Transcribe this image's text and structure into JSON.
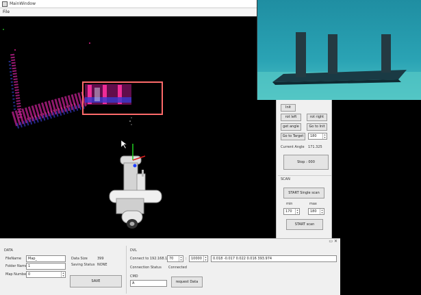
{
  "window": {
    "title": "MainWindow"
  },
  "menu": {
    "file": "File"
  },
  "controls": {
    "init_button": "Init",
    "rot_left_button": "rot left",
    "rot_right_button": "rot right",
    "get_angle_button": "get angle",
    "go_init_button": "Go to Init",
    "go_target_button": "Go to Target",
    "target_value": "180",
    "current_angle_label": "Current Angle",
    "current_angle_value": "171.325",
    "stop_button": "Stop : 000",
    "scan_section_label": "SCAN",
    "start_single_scan_button": "START Single scan",
    "min_label": "min",
    "max_label": "max",
    "min_value": "170",
    "max_value": "180",
    "start_scan_button": "START scan"
  },
  "dock": {
    "float_icon": "▭",
    "close_icon": "✕",
    "data": {
      "section_label": "DATA",
      "filename_label": "FileName",
      "filename_value": "Map_",
      "folder_label": "Folder Name",
      "folder_value": "1",
      "mapnum_label": "Map Number",
      "mapnum_value": "0",
      "data_size_label": "Data Size",
      "data_size_value": "399",
      "saving_status_label": "Saving Status",
      "saving_status_value": "NONE",
      "save_button": "SAVE"
    },
    "dvl": {
      "section_label": "DVL",
      "connect_label": "Connect to 192.168.1.",
      "ip_suffix": "70",
      "port_value": "10000",
      "port_sep": ":",
      "readout": "0.018 -0.017 0.022 0.016 393.974",
      "conn_status_label": "Connection Status",
      "conn_status_value": "Connected",
      "cmd_label": "CMD",
      "cmd_value": "A",
      "request_button": "request Data"
    }
  },
  "colors": {
    "point_cloud_pink": "#e0208f",
    "point_cloud_blue": "#2030c0",
    "roi_box": "#ff6b6b",
    "water": "#2a9cae"
  },
  "icons": [
    "window-icon",
    "spin-up-icon",
    "spin-down-icon",
    "float-dock-icon",
    "close-dock-icon",
    "cursor-icon"
  ]
}
